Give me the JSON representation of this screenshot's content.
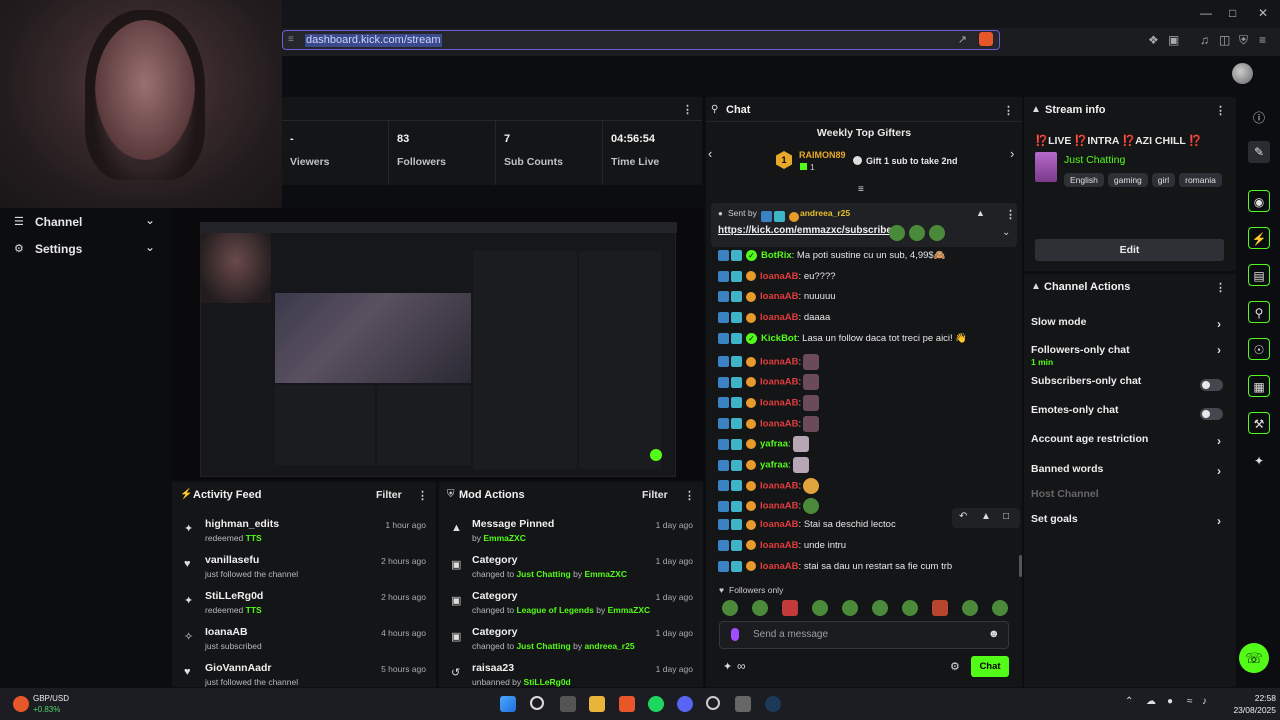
{
  "browser": {
    "url": "dashboard.kick.com/stream"
  },
  "nav": {
    "channel": "Channel",
    "settings": "Settings"
  },
  "stats": [
    {
      "value": "-",
      "label": "Viewers"
    },
    {
      "value": "83",
      "label": "Followers"
    },
    {
      "value": "7",
      "label": "Sub Counts"
    },
    {
      "value": "04:56:54",
      "label": "Time Live"
    }
  ],
  "activity": {
    "title": "Activity Feed",
    "filter": "Filter",
    "items": [
      {
        "name": "highman_edits",
        "pre": "redeemed ",
        "hl": "TTS",
        "time": "1 hour ago",
        "icon": "gift"
      },
      {
        "name": "vanillasefu",
        "pre": "just followed the channel",
        "hl": "",
        "time": "2 hours ago",
        "icon": "heart"
      },
      {
        "name": "StiLLeRg0d",
        "pre": "redeemed ",
        "hl": "TTS",
        "time": "2 hours ago",
        "icon": "gift"
      },
      {
        "name": "IoanaAB",
        "pre": "just subscribed",
        "hl": "",
        "time": "4 hours ago",
        "icon": "star"
      },
      {
        "name": "GioVannAadr",
        "pre": "just followed the channel",
        "hl": "",
        "time": "5 hours ago",
        "icon": "heart"
      }
    ]
  },
  "mod": {
    "title": "Mod Actions",
    "filter": "Filter",
    "items": [
      {
        "name": "Message Pinned",
        "pre": "by ",
        "hl": "EmmaZXC",
        "mid": "",
        "hl2": "",
        "time": "1 day ago",
        "icon": "pin"
      },
      {
        "name": "Category",
        "pre": "changed to ",
        "hl": "Just Chatting",
        "mid": " by ",
        "hl2": "EmmaZXC",
        "time": "1 day ago",
        "icon": "cat"
      },
      {
        "name": "Category",
        "pre": "changed to ",
        "hl": "League of Legends",
        "mid": "  by ",
        "hl2": "EmmaZXC",
        "time": "1 day ago",
        "icon": "cat"
      },
      {
        "name": "Category",
        "pre": "changed to ",
        "hl": "Just Chatting",
        "mid": " by ",
        "hl2": "andreea_r25",
        "time": "1 day ago",
        "icon": "cat"
      },
      {
        "name": "raisaa23",
        "pre": "unbanned by ",
        "hl": "StiLLeRg0d",
        "mid": "",
        "hl2": "",
        "time": "1 day ago",
        "icon": "undo"
      }
    ]
  },
  "chat": {
    "title": "Chat",
    "gifters_title": "Weekly Top Gifters",
    "gifter_rank": "1",
    "gifter_name": "RAIMON89",
    "gifter_count": "1",
    "gift_cta": "Gift 1 sub to take 2nd",
    "pinned_by_label": "Sent by",
    "pinned_by": "andreea_r25",
    "pinned_link": "https://kick.com/emmazxc/subscribe",
    "messages": [
      {
        "user": "BotRix",
        "text": ": Ma poti sustine cu un sub, 4,99$🙈",
        "color": "grn",
        "bot": true,
        "emote": ""
      },
      {
        "user": "IoanaAB",
        "text": ": eu????",
        "color": "red",
        "bot": false,
        "emote": ""
      },
      {
        "user": "IoanaAB",
        "text": ": nuuuuu",
        "color": "red",
        "bot": false,
        "emote": ""
      },
      {
        "user": "IoanaAB",
        "text": ": daaaa",
        "color": "red",
        "bot": false,
        "emote": ""
      },
      {
        "user": "KickBot",
        "text": ": Lasa un follow daca tot treci pe aici! 👋",
        "color": "grn",
        "bot": true,
        "emote": ""
      },
      {
        "user": "IoanaAB",
        "text": ":",
        "color": "red",
        "bot": false,
        "emote": "pink"
      },
      {
        "user": "IoanaAB",
        "text": ":",
        "color": "red",
        "bot": false,
        "emote": "pink"
      },
      {
        "user": "IoanaAB",
        "text": ":",
        "color": "red",
        "bot": false,
        "emote": "pink"
      },
      {
        "user": "IoanaAB",
        "text": ":",
        "color": "red",
        "bot": false,
        "emote": "pink"
      },
      {
        "user": "yafraa",
        "text": ":",
        "color": "grn",
        "bot": false,
        "emote": "lt"
      },
      {
        "user": "yafraa",
        "text": ":",
        "color": "grn",
        "bot": false,
        "emote": "lt"
      },
      {
        "user": "IoanaAB",
        "text": ":",
        "color": "red",
        "bot": false,
        "emote": "face"
      },
      {
        "user": "IoanaAB",
        "text": ":",
        "color": "red",
        "bot": false,
        "emote": "frog"
      },
      {
        "user": "IoanaAB",
        "text": ": Stai sa deschid lectoc",
        "color": "red",
        "bot": false,
        "emote": ""
      },
      {
        "user": "IoanaAB",
        "text": ": unde intru",
        "color": "red",
        "bot": false,
        "emote": ""
      },
      {
        "user": "IoanaAB",
        "text": ": stai sa dau un restart sa fie cum trb",
        "color": "red",
        "bot": false,
        "emote": ""
      }
    ],
    "followers_only": "Followers only",
    "placeholder": "Send a message",
    "send": "Chat"
  },
  "stream_info": {
    "title": "Stream info",
    "stream_title": "⁉️LIVE ⁉️INTRA ⁉️AZI CHILL ⁉️",
    "category": "Just Chatting",
    "tags": [
      "English",
      "gaming",
      "girl",
      "romania"
    ],
    "edit": "Edit"
  },
  "channel_actions": {
    "title": "Channel Actions",
    "rows": [
      {
        "label": "Slow mode",
        "sub": "",
        "ctl": "chev"
      },
      {
        "label": "Followers-only chat",
        "sub": "1 min",
        "ctl": "chev"
      },
      {
        "label": "Subscribers-only chat",
        "sub": "",
        "ctl": "toggle"
      },
      {
        "label": "Emotes-only chat",
        "sub": "",
        "ctl": "toggle"
      },
      {
        "label": "Account age restriction",
        "sub": "",
        "ctl": "chev"
      },
      {
        "label": "Banned words",
        "sub": "",
        "ctl": "chev"
      },
      {
        "label": "Host Channel",
        "sub": "",
        "ctl": "none"
      },
      {
        "label": "Set goals",
        "sub": "",
        "ctl": "chev"
      }
    ]
  },
  "taskbar": {
    "ticker_pair": "GBP/USD",
    "ticker_change": "+0.83%",
    "time": "22:58",
    "date": "23/08/2025"
  },
  "colors": {
    "accent": "#53fc18",
    "bg": "#0c0d10",
    "panel": "#141517"
  }
}
